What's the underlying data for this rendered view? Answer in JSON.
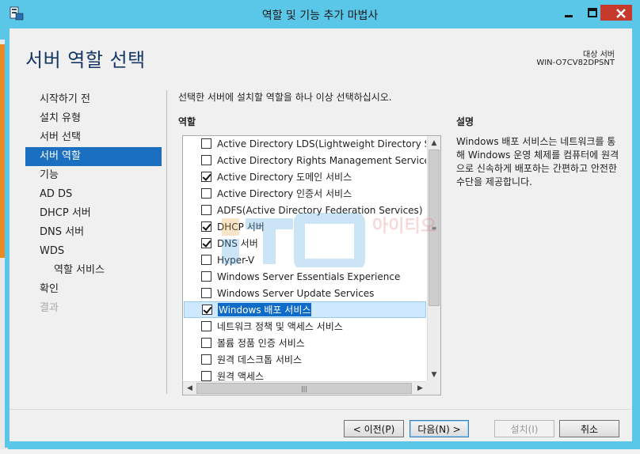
{
  "window": {
    "title": "역할 및 기능 추가 마법사",
    "controls": {
      "minimize": "—",
      "maximize": "□",
      "close": "✕"
    }
  },
  "header": {
    "title": "서버 역할 선택",
    "destination_label": "대상 서버",
    "destination_server": "WIN-O7CV82DPSNT"
  },
  "nav": {
    "items": [
      {
        "label": "시작하기 전",
        "state": "normal"
      },
      {
        "label": "설치 유형",
        "state": "normal"
      },
      {
        "label": "서버 선택",
        "state": "normal"
      },
      {
        "label": "서버 역할",
        "state": "active"
      },
      {
        "label": "기능",
        "state": "normal"
      },
      {
        "label": "AD DS",
        "state": "normal"
      },
      {
        "label": "DHCP 서버",
        "state": "normal"
      },
      {
        "label": "DNS 서버",
        "state": "normal"
      },
      {
        "label": "WDS",
        "state": "normal"
      },
      {
        "label": "역할 서비스",
        "state": "sub"
      },
      {
        "label": "확인",
        "state": "normal"
      },
      {
        "label": "결과",
        "state": "disabled"
      }
    ]
  },
  "main": {
    "instruction": "선택한 서버에 설치할 역할을 하나 이상 선택하십시오.",
    "roles_heading": "역할",
    "roles": [
      {
        "label": "Active Directory LDS(Lightweight Directory Services)",
        "checked": false
      },
      {
        "label": "Active Directory Rights Management Services",
        "checked": false
      },
      {
        "label": "Active Directory 도메인 서비스",
        "checked": true
      },
      {
        "label": "Active Directory 인증서 서비스",
        "checked": false
      },
      {
        "label": "ADFS(Active Directory Federation Services)",
        "checked": false
      },
      {
        "label": "DHCP 서버",
        "checked": true
      },
      {
        "label": "DNS 서버",
        "checked": true
      },
      {
        "label": "Hyper-V",
        "checked": false
      },
      {
        "label": "Windows Server Essentials Experience",
        "checked": false
      },
      {
        "label": "Windows Server Update Services",
        "checked": false
      },
      {
        "label": "Windows 배포 서비스",
        "checked": true,
        "selected": true
      },
      {
        "label": "네트워크 정책 및 액세스 서비스",
        "checked": false
      },
      {
        "label": "볼륨 정품 인증 서비스",
        "checked": false
      },
      {
        "label": "원격 데스크톱 서비스",
        "checked": false
      },
      {
        "label": "원격 액세스",
        "checked": false
      }
    ],
    "scroll_glyphs": {
      "up": "▲",
      "down": "▼",
      "left": "◀",
      "right": "▶",
      "grip_v": "≡",
      "grip_h": "|||"
    }
  },
  "description": {
    "heading": "설명",
    "text": "Windows 배포 서비스는 네트워크를 통해 Windows 운영 체제를 컴퓨터에 원격으로 신속하게 배포하는 간편하고 안전한 수단을 제공합니다."
  },
  "watermark": {
    "text": "아이티오"
  },
  "buttons": {
    "prev": "< 이전(P)",
    "next": "다음(N) >",
    "install": "설치(I)",
    "cancel": "취소"
  },
  "colors": {
    "title_bar": "#5bc7e8",
    "accent_nav": "#1b6fc0",
    "close_button": "#c7392b",
    "header_text": "#163864"
  }
}
